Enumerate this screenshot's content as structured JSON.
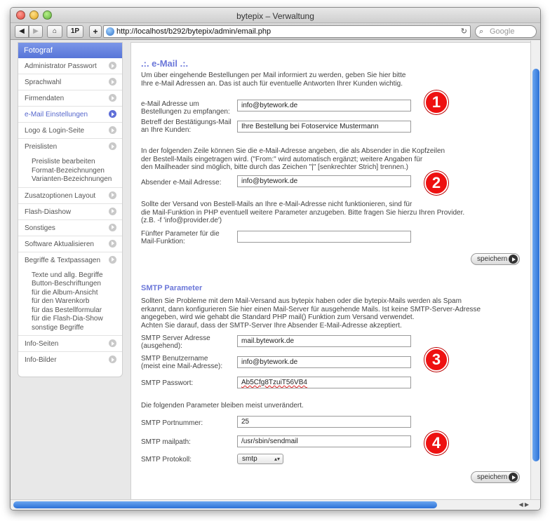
{
  "window": {
    "title": "bytepix – Verwaltung"
  },
  "toolbar": {
    "back": "◀",
    "forward": "▶",
    "home": "⌂",
    "onep": "1P",
    "plus": "+",
    "url": "http://localhost/b292/bytepix/admin/email.php",
    "reload": "↻",
    "search_placeholder": "Google"
  },
  "sidebar": {
    "header": "Fotograf",
    "items": [
      "Administrator Passwort",
      "Sprachwahl",
      "Firmendaten",
      "e-Mail Einstellungen",
      "Logo & Login-Seite",
      "Preislisten",
      "Zusatzoptionen Layout",
      "Flash-Diashow",
      "Sonstiges",
      "Software Aktualisieren",
      "Begriffe & Textpassagen",
      "Info-Seiten",
      "Info-Bilder"
    ],
    "preislisten_sub": [
      "Preisliste bearbeiten",
      "Format-Bezeichnungen",
      "Varianten-Bezeichnungen"
    ],
    "begriffe_sub": [
      "Texte und allg. Begriffe",
      "Button-Beschriftungen",
      "für die Album-Ansicht",
      "für den Warenkorb",
      "für das Bestellformular",
      "für die Flash-Dia-Show",
      "sonstige Begriffe"
    ]
  },
  "email": {
    "title": ".:. e-Mail .:.",
    "intro": [
      "Um über eingehende Bestellungen per Mail informiert zu werden, geben Sie hier bitte",
      "Ihre e-Mail Adressen an. Das ist auch für eventuelle Antworten Ihrer Kunden wichtig."
    ],
    "addr_label": [
      "e-Mail Adresse um",
      "Bestellungen zu empfangen:"
    ],
    "addr_value": "info@bytework.de",
    "subject_label": [
      "Betreff der Bestätigungs-Mail",
      "an Ihre Kunden:"
    ],
    "subject_value": "Ihre Bestellung bei Fotoservice Mustermann",
    "sender_info": [
      "In der folgenden Zeile können Sie die e-Mail-Adresse angeben, die als Absender in die Kopfzeilen",
      "der Bestell-Mails eingetragen wird. (\"From:\" wird automatisch ergänzt; weitere Angaben für",
      "den Mailheader sind möglich, bitte durch das Zeichen \"|\" [senkrechter Strich] trennen.)"
    ],
    "sender_label": "Absender e-Mail Adresse:",
    "sender_value": "info@bytework.de",
    "fifth_info": [
      "Sollte der Versand von Bestell-Mails an Ihre e-Mail-Adresse nicht funktionieren, sind für",
      "die Mail-Funktion in PHP eventuell weitere Parameter anzugeben. Bitte fragen Sie hierzu Ihren Provider.",
      "(z.B. -f 'info@provider.de')"
    ],
    "fifth_label": [
      "Fünfter Parameter für die",
      "Mail-Funktion:"
    ],
    "fifth_value": "",
    "save": "speichern"
  },
  "smtp": {
    "title": "SMTP Parameter",
    "intro": [
      "Sollten Sie Probleme mit dem Mail-Versand aus bytepix haben oder die bytepix-Mails werden als Spam",
      "erkannt, dann konfigurieren Sie hier einen Mail-Server für ausgehende Mails. Ist keine SMTP-Server-Adresse",
      "angegeben, wird wie gehabt die Standard PHP mail() Funktion zum Versand verwendet.",
      "Achten Sie darauf, dass der SMTP-Server Ihre Absender E-Mail-Adresse akzeptiert."
    ],
    "server_label": [
      "SMTP Server Adresse",
      "(ausgehend):"
    ],
    "server_value": "mail.bytework.de",
    "user_label": [
      "SMTP Benutzername",
      "(meist eine Mail-Adresse):"
    ],
    "user_value": "info@bytework.de",
    "pass_label": "SMTP Passwort:",
    "pass_value": "Ab5Cfg8TzuiT56VB4",
    "note": "Die folgenden Parameter bleiben meist unverändert.",
    "port_label": "SMTP Portnummer:",
    "port_value": "25",
    "mailpath_label": "SMTP mailpath:",
    "mailpath_value": "/usr/sbin/sendmail",
    "proto_label": "SMTP Protokoll:",
    "proto_value": "smtp",
    "save": "speichern"
  },
  "badges": [
    "1",
    "2",
    "3",
    "4"
  ]
}
